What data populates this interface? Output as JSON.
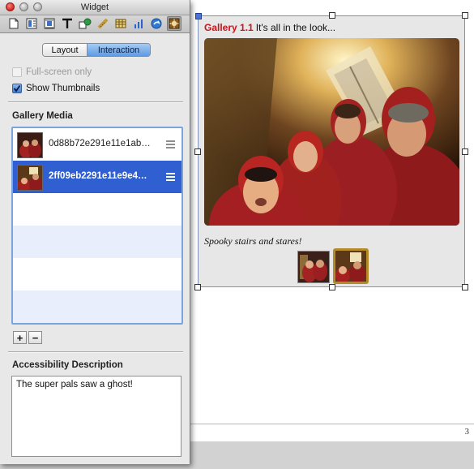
{
  "window": {
    "title": "Widget"
  },
  "toolbar": {
    "icons": [
      "document-icon",
      "layout-icon",
      "wrap-icon",
      "text-icon",
      "graphic-icon",
      "metrics-icon",
      "table-icon",
      "chart-icon",
      "link-icon",
      "widget-icon"
    ],
    "active": "widget-icon"
  },
  "tabs": {
    "layout": "Layout",
    "interaction": "Interaction",
    "selected": "Interaction"
  },
  "options": {
    "fullscreen": {
      "label": "Full-screen only",
      "checked": false,
      "enabled": false
    },
    "thumbnails": {
      "label": "Show Thumbnails",
      "checked": true,
      "enabled": true
    }
  },
  "gallery_media": {
    "heading": "Gallery Media",
    "items": [
      {
        "name": "0d88b72e291e11e1ab…",
        "selected": false
      },
      {
        "name": "2ff09eb2291e11e9e4…",
        "selected": true
      }
    ],
    "add_label": "+",
    "remove_label": "−"
  },
  "accessibility": {
    "heading": "Accessibility Description",
    "value": "The super pals saw a ghost!"
  },
  "widget": {
    "title": "Gallery 1.1",
    "subtitle": "It's all in the look...",
    "caption": "Spooky stairs and stares!",
    "thumbnail_count": 2,
    "selected_thumbnail": 2
  },
  "page": {
    "number": "3"
  },
  "colors": {
    "accent": "#2f5fd1",
    "title_red": "#c8141b",
    "selection_border": "#7aa6dc"
  }
}
